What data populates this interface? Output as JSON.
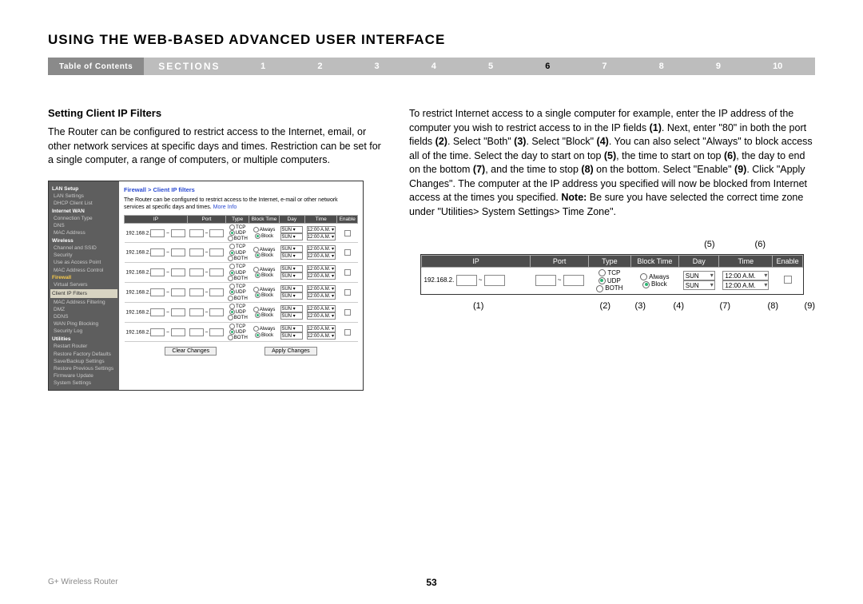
{
  "page_title": "USING THE WEB-BASED ADVANCED USER INTERFACE",
  "nav": {
    "toc": "Table of Contents",
    "sections": "SECTIONS",
    "numbers": [
      "1",
      "2",
      "3",
      "4",
      "5",
      "6",
      "7",
      "8",
      "9",
      "10"
    ],
    "active": "6"
  },
  "heading": "Setting Client IP Filters",
  "left_paragraph": "The Router can be configured to restrict access to the Internet, email, or other network services at specific days and times. Restriction can be set for a single computer, a range of computers, or multiple computers.",
  "right_paragraph_parts": [
    "To restrict Internet access to a single computer for example, enter the IP address of the computer you wish to restrict access to in the IP fields ",
    "(1)",
    ". Next, enter \"80\" in both the port fields ",
    "(2)",
    ". Select \"Both\" ",
    "(3)",
    ". Select \"Block\" ",
    "(4)",
    ". You can also select \"Always\" to block access all of the time. Select the day to start on top ",
    "(5)",
    ", the time to start on top ",
    "(6)",
    ", the day to end on the bottom ",
    "(7)",
    ", and the time to stop ",
    "(8)",
    " on the bottom. Select \"Enable\" ",
    "(9)",
    ". Click \"Apply Changes\". The computer at the IP address you specified will now be blocked from Internet access at the times you specified. ",
    "Note:",
    " Be sure you have selected the correct time zone under \"Utilities> System Settings> Time Zone\"."
  ],
  "left_fig": {
    "sidebar": {
      "lan_setup": "LAN Setup",
      "lan_settings": "LAN Settings",
      "dhcp": "DHCP Client List",
      "wan": "Internet WAN",
      "conn": "Connection Type",
      "dns": "DNS",
      "mac": "MAC Address",
      "wireless": "Wireless",
      "channel": "Channel and SSID",
      "security": "Security",
      "uap": "Use as Access Point",
      "mac2": "MAC Address Control",
      "firewall": "Firewall",
      "vs": "Virtual Servers",
      "cipf": "Client IP Filters",
      "macf": "MAC Address Filtering",
      "dmz": "DMZ",
      "ddns": "DDNS",
      "ping": "WAN Ping Blocking",
      "slog": "Security Log",
      "utilities": "Utilities",
      "restart": "Restart Router",
      "defaults": "Restore Factory Defaults",
      "save": "Save/Backup Settings",
      "restore": "Restore Previous Settings",
      "fw": "Firmware Update",
      "sys": "System Settings"
    },
    "crumb": "Firewall > Client IP filters",
    "desc": "The Router can be configured to restrict access to the Internet, e-mail or other network services at specific days and times.",
    "more": "More Info",
    "headers": [
      "IP",
      "Port",
      "Type",
      "Block Time",
      "Day",
      "Time",
      "Enable"
    ],
    "type_opts": [
      "TCP",
      "UDP",
      "BOTH"
    ],
    "bt_opts": [
      "Always",
      "Block"
    ],
    "ip_prefix": "192.168.2.",
    "day": "SUN",
    "time": "12:00 A.M.",
    "rows": 6,
    "btn_clear": "Clear Changes",
    "btn_apply": "Apply Changes"
  },
  "right_fig": {
    "headers": [
      "IP",
      "Port",
      "Type",
      "Block Time",
      "Day",
      "Time",
      "Enable"
    ],
    "type_opts": [
      "TCP",
      "UDP",
      "BOTH"
    ],
    "bt_opts": [
      "Always",
      "Block"
    ],
    "ip_prefix": "192.168.2.",
    "day": "SUN",
    "time": "12:00 A.M."
  },
  "annot_top": [
    "(5)",
    "(6)"
  ],
  "annot_bottom": [
    "(1)",
    "(2)",
    "(3)",
    "(4)",
    "(7)",
    "(8)",
    "(9)"
  ],
  "footer_left": "G+ Wireless Router",
  "page_number": "53"
}
